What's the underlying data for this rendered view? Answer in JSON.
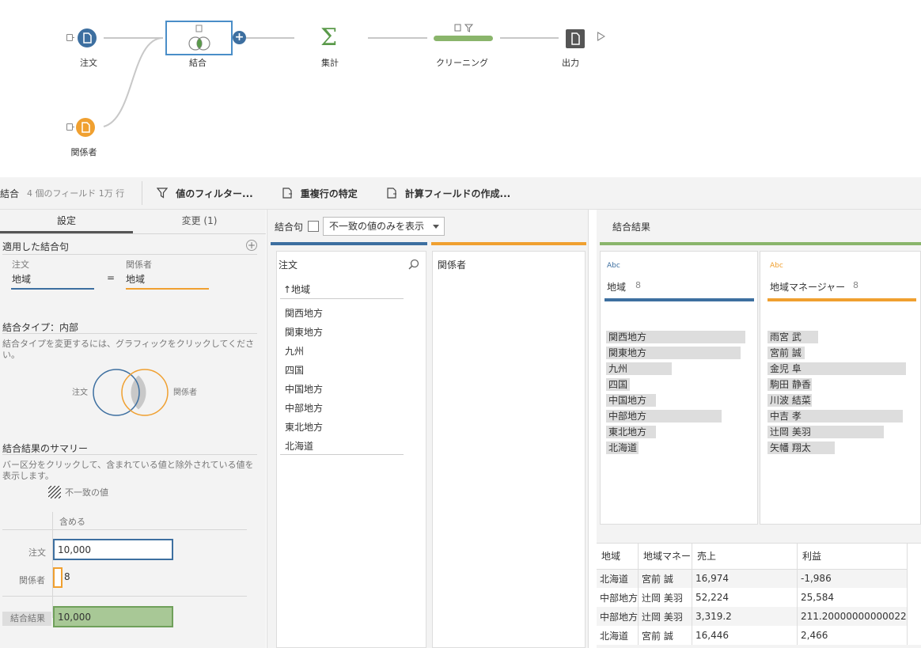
{
  "flow": {
    "nodes": {
      "orders": "注文",
      "join": "結合",
      "aggregate": "集計",
      "cleaning": "クリーニング",
      "output": "出力",
      "people": "関係者"
    }
  },
  "toolbar": {
    "step_name": "結合",
    "step_info": "4 個のフィールド  1万 行",
    "filter_label": "値のフィルター...",
    "duplicate_label": "重複行の特定",
    "calc_label": "計算フィールドの作成..."
  },
  "settings": {
    "tab_settings": "設定",
    "tab_changes": "変更 (1)",
    "applied_clause_title": "適用した結合句",
    "left_table": "注文",
    "right_table": "関係者",
    "left_field": "地域",
    "operator": "=",
    "right_field": "地域",
    "join_type_title": "結合タイプ：内部",
    "join_type_help": "結合タイプを変更するには、グラフィックをクリックしてください。",
    "venn_left": "注文",
    "venn_right": "関係者",
    "summary_title": "結合結果のサマリー",
    "summary_help": "バー区分をクリックして、含まれている値と除外されている値を表示します。",
    "legend_unmatched": "不一致の値",
    "col_included": "含める",
    "rows": [
      {
        "label": "注文",
        "value": "10,000"
      },
      {
        "label": "関係者",
        "value": "8"
      },
      {
        "label": "結合結果",
        "value": "10,000"
      }
    ],
    "bar_fill_fraction": [
      1.0,
      0.0008,
      1.0
    ]
  },
  "clause": {
    "title": "結合句",
    "dropdown": "不一致の値のみを表示",
    "left_header": "注文",
    "right_header": "関係者",
    "field_header": "↑地域",
    "values": [
      "関西地方",
      "関東地方",
      "九州",
      "四国",
      "中国地方",
      "中部地方",
      "東北地方",
      "北海道"
    ]
  },
  "result": {
    "title": "結合結果",
    "left_type": "Abc",
    "left_field": "地域",
    "left_count": "8",
    "right_type": "Abc",
    "right_field": "地域マネージャー",
    "right_count": "8",
    "left_values": [
      {
        "label": "関西地方",
        "frac": 0.95
      },
      {
        "label": "関東地方",
        "frac": 0.92
      },
      {
        "label": "九州",
        "frac": 0.45
      },
      {
        "label": "四国",
        "frac": 0.16
      },
      {
        "label": "中国地方",
        "frac": 0.34
      },
      {
        "label": "中部地方",
        "frac": 0.79
      },
      {
        "label": "東北地方",
        "frac": 0.34
      },
      {
        "label": "北海道",
        "frac": 0.22
      }
    ],
    "right_values": [
      {
        "label": "雨宮 武",
        "frac": 0.34
      },
      {
        "label": "宮前 誠",
        "frac": 0.25
      },
      {
        "label": "金児 阜",
        "frac": 0.93
      },
      {
        "label": "駒田 静香",
        "frac": 0.3
      },
      {
        "label": "川波 結菜",
        "frac": 0.3
      },
      {
        "label": "中吉 孝",
        "frac": 0.91
      },
      {
        "label": "辻岡 美羽",
        "frac": 0.78
      },
      {
        "label": "矢幡 翔太",
        "frac": 0.45
      }
    ],
    "grid_headers": [
      "地域",
      "地域マネー",
      "売上",
      "利益"
    ],
    "grid_rows": [
      [
        "北海道",
        "宮前 誠",
        "16,974",
        "-1,986"
      ],
      [
        "中部地方",
        "辻岡 美羽",
        "52,224",
        "25,584"
      ],
      [
        "中部地方",
        "辻岡 美羽",
        "3,319.2",
        "211.20000000000022"
      ],
      [
        "北海道",
        "宮前 誠",
        "16,446",
        "2,466"
      ]
    ]
  },
  "colors": {
    "blue": "#3d6fa0",
    "orange": "#f0a030",
    "green": "#8ab56b"
  }
}
